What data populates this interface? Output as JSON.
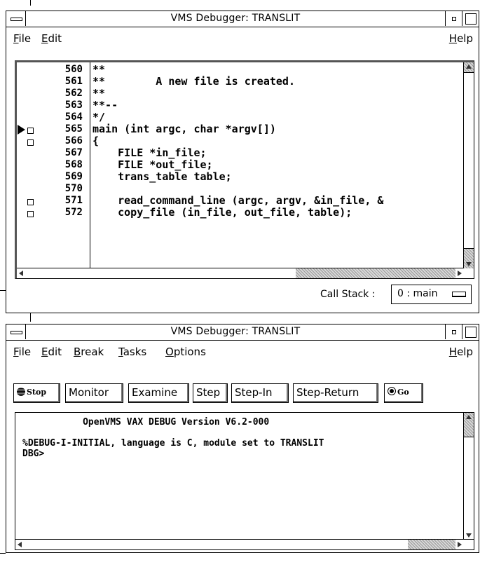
{
  "source_window": {
    "title": "VMS Debugger: TRANSLIT",
    "menu": [
      "File",
      "Edit"
    ],
    "help": "Help",
    "lines": [
      {
        "num": "560",
        "code": "**",
        "breakpoint": false,
        "current": false
      },
      {
        "num": "561",
        "code": "**        A new file is created.",
        "breakpoint": false,
        "current": false
      },
      {
        "num": "562",
        "code": "**",
        "breakpoint": false,
        "current": false
      },
      {
        "num": "563",
        "code": "**--",
        "breakpoint": false,
        "current": false
      },
      {
        "num": "564",
        "code": "*/",
        "breakpoint": false,
        "current": false
      },
      {
        "num": "565",
        "code": "main (int argc, char *argv[])",
        "breakpoint": true,
        "current": true
      },
      {
        "num": "566",
        "code": "{",
        "breakpoint": true,
        "current": false
      },
      {
        "num": "567",
        "code": "    FILE *in_file;",
        "breakpoint": false,
        "current": false
      },
      {
        "num": "568",
        "code": "    FILE *out_file;",
        "breakpoint": false,
        "current": false
      },
      {
        "num": "569",
        "code": "    trans_table table;",
        "breakpoint": false,
        "current": false
      },
      {
        "num": "570",
        "code": "",
        "breakpoint": false,
        "current": false
      },
      {
        "num": "571",
        "code": "    read_command_line (argc, argv, &in_file, &",
        "breakpoint": true,
        "current": false
      },
      {
        "num": "572",
        "code": "    copy_file (in_file, out_file, table);",
        "breakpoint": true,
        "current": false
      }
    ],
    "call_stack_label": "Call Stack :",
    "call_stack_value": "0 : main"
  },
  "control_window": {
    "title": "VMS Debugger: TRANSLIT",
    "menu": [
      "File",
      "Edit",
      "Break",
      "Tasks",
      "Options"
    ],
    "help": "Help",
    "buttons": {
      "stop": "Stop",
      "monitor": "Monitor",
      "examine": "Examine",
      "step": "Step",
      "step_in": "Step-In",
      "step_return": "Step-Return",
      "go": "Go"
    },
    "console": [
      "           OpenVMS VAX DEBUG Version V6.2-000",
      "",
      "%DEBUG-I-INITIAL, language is C, module set to TRANSLIT",
      "DBG>"
    ]
  }
}
